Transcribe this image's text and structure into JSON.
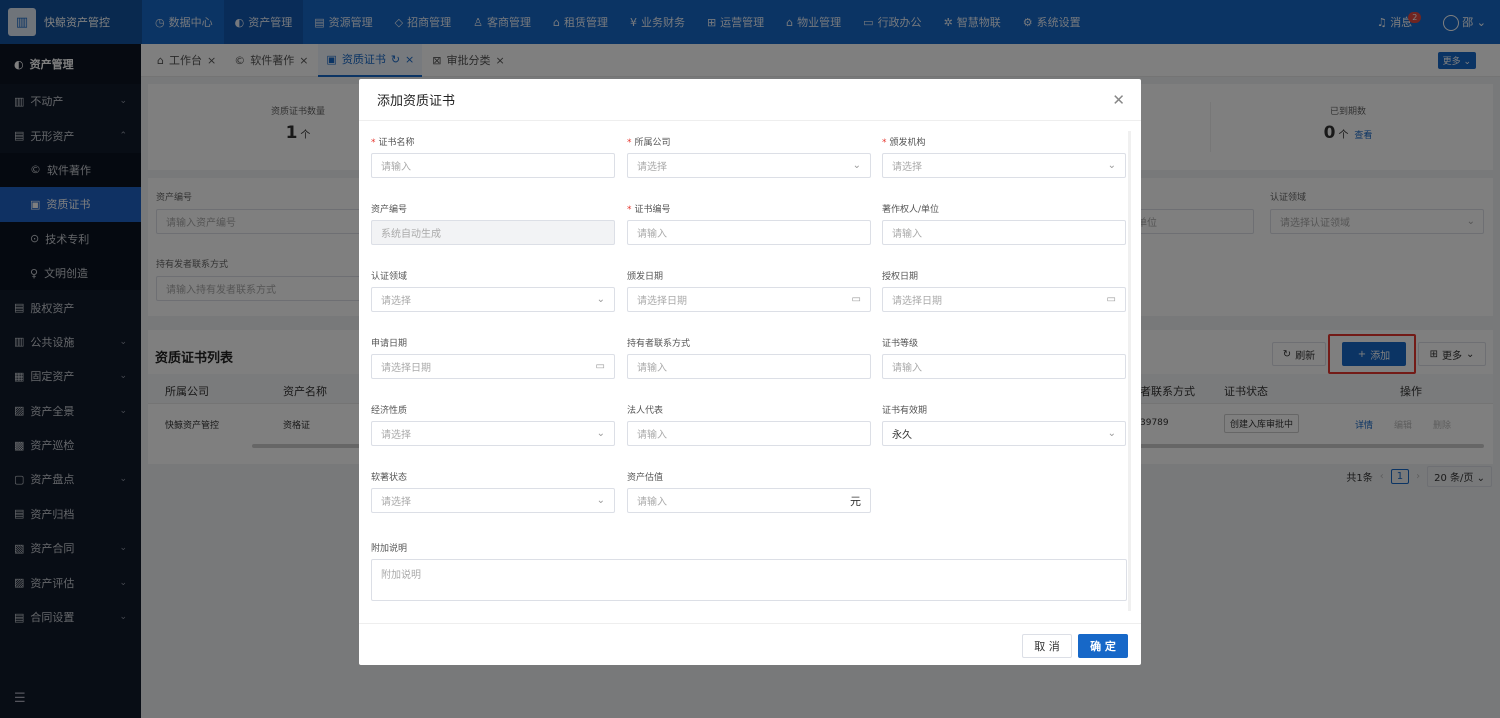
{
  "app": {
    "logo_icon": "building-icon",
    "title": "快鲸资产管控"
  },
  "topnav": [
    {
      "icon": "◷",
      "label": "数据中心"
    },
    {
      "icon": "◐",
      "label": "资产管理",
      "active": true
    },
    {
      "icon": "▤",
      "label": "资源管理"
    },
    {
      "icon": "◇",
      "label": "招商管理"
    },
    {
      "icon": "♙",
      "label": "客商管理"
    },
    {
      "icon": "⌂",
      "label": "租赁管理"
    },
    {
      "icon": "¥",
      "label": "业务财务"
    },
    {
      "icon": "⊞",
      "label": "运营管理"
    },
    {
      "icon": "⌂",
      "label": "物业管理"
    },
    {
      "icon": "▭",
      "label": "行政办公"
    },
    {
      "icon": "✲",
      "label": "智慧物联"
    },
    {
      "icon": "⚙",
      "label": "系统设置"
    }
  ],
  "topright": {
    "messages_label": "消息",
    "messages_count": "2",
    "user_label": "邵"
  },
  "sidebar": {
    "header": "资产管理",
    "items": [
      {
        "icon": "▥",
        "label": "不动产",
        "chev": "⌄"
      },
      {
        "icon": "▤",
        "label": "无形资产",
        "chev": "⌃"
      },
      {
        "icon": "©",
        "label": "软件著作",
        "sub": true
      },
      {
        "icon": "▣",
        "label": "资质证书",
        "sub": true,
        "active": true
      },
      {
        "icon": "⊙",
        "label": "技术专利",
        "sub": true
      },
      {
        "icon": "♀",
        "label": "文明创造",
        "sub": true
      },
      {
        "icon": "▤",
        "label": "股权资产",
        "chev": ""
      },
      {
        "icon": "▥",
        "label": "公共设施",
        "chev": "⌄"
      },
      {
        "icon": "▦",
        "label": "固定资产",
        "chev": "⌄"
      },
      {
        "icon": "▨",
        "label": "资产全景",
        "chev": "⌄"
      },
      {
        "icon": "▩",
        "label": "资产巡检",
        "chev": ""
      },
      {
        "icon": "▢",
        "label": "资产盘点",
        "chev": "⌄"
      },
      {
        "icon": "▤",
        "label": "资产归档",
        "chev": ""
      },
      {
        "icon": "▧",
        "label": "资产合同",
        "chev": "⌄"
      },
      {
        "icon": "▨",
        "label": "资产评估",
        "chev": "⌄"
      },
      {
        "icon": "▤",
        "label": "合同设置",
        "chev": "⌄"
      }
    ],
    "collapse_icon": "☰"
  },
  "tabs": [
    {
      "icon": "⌂",
      "label": "工作台",
      "close": "×"
    },
    {
      "icon": "©",
      "label": "软件著作",
      "close": "×"
    },
    {
      "icon": "▣",
      "label": "资质证书",
      "refresh": "↻",
      "close": "×",
      "active": true
    },
    {
      "icon": "⊠",
      "label": "审批分类",
      "close": "×"
    }
  ],
  "more_tab": "更多 ⌄",
  "stats": [
    {
      "label": "资质证书数量",
      "value": "1",
      "unit": "个"
    },
    {
      "label": "已到期数",
      "value": "0",
      "unit": "个",
      "link": "查看"
    }
  ],
  "filters": {
    "asset_no_label": "资产编号",
    "asset_no_placeholder": "请输入资产编号",
    "holder_contact_label": "持有发者联系方式",
    "holder_contact_placeholder": "请输入持有发者联系方式",
    "unit_partial": "单位",
    "cert_domain_label": "认证领域",
    "cert_domain_placeholder": "请选择认证领域"
  },
  "list": {
    "title": "资质证书列表",
    "refresh_label": "刷新",
    "add_label": "添加",
    "more_label": "更多",
    "columns": [
      "所属公司",
      "资产名称",
      "者联系方式",
      "证书状态",
      "操作"
    ],
    "rows": [
      {
        "company": "快鲸资产管控",
        "name": "资格证",
        "contact": "39789",
        "status": "创建入库审批中",
        "actions": [
          "详情",
          "编辑",
          "删除"
        ]
      }
    ],
    "pager": {
      "total": "共1条",
      "page": "1",
      "size": "20 条/页"
    }
  },
  "modal": {
    "title": "添加资质证书",
    "fields": [
      {
        "label": "证书名称",
        "required": true,
        "placeholder": "请输入",
        "kind": "input"
      },
      {
        "label": "所属公司",
        "required": true,
        "placeholder": "请选择",
        "kind": "select"
      },
      {
        "label": "颁发机构",
        "required": true,
        "placeholder": "请选择",
        "kind": "select"
      },
      {
        "label": "资产编号",
        "required": false,
        "placeholder": "系统自动生成",
        "kind": "disabled"
      },
      {
        "label": "证书编号",
        "required": true,
        "placeholder": "请输入",
        "kind": "input"
      },
      {
        "label": "著作权人/单位",
        "required": false,
        "placeholder": "请输入",
        "kind": "input"
      },
      {
        "label": "认证领域",
        "required": false,
        "placeholder": "请选择",
        "kind": "select"
      },
      {
        "label": "颁发日期",
        "required": false,
        "placeholder": "请选择日期",
        "kind": "date"
      },
      {
        "label": "授权日期",
        "required": false,
        "placeholder": "请选择日期",
        "kind": "date"
      },
      {
        "label": "申请日期",
        "required": false,
        "placeholder": "请选择日期",
        "kind": "date"
      },
      {
        "label": "持有者联系方式",
        "required": false,
        "placeholder": "请输入",
        "kind": "input"
      },
      {
        "label": "证书等级",
        "required": false,
        "placeholder": "请输入",
        "kind": "input"
      },
      {
        "label": "经济性质",
        "required": false,
        "placeholder": "请选择",
        "kind": "select"
      },
      {
        "label": "法人代表",
        "required": false,
        "placeholder": "请输入",
        "kind": "input"
      },
      {
        "label": "证书有效期",
        "required": false,
        "value": "永久",
        "kind": "select-filled"
      },
      {
        "label": "软著状态",
        "required": false,
        "placeholder": "请选择",
        "kind": "select"
      },
      {
        "label": "资产估值",
        "required": false,
        "placeholder": "请输入",
        "kind": "suffix",
        "suffix": "元"
      }
    ],
    "note_label": "附加说明",
    "note_placeholder": "附加说明",
    "cancel": "取 消",
    "confirm": "确 定"
  }
}
